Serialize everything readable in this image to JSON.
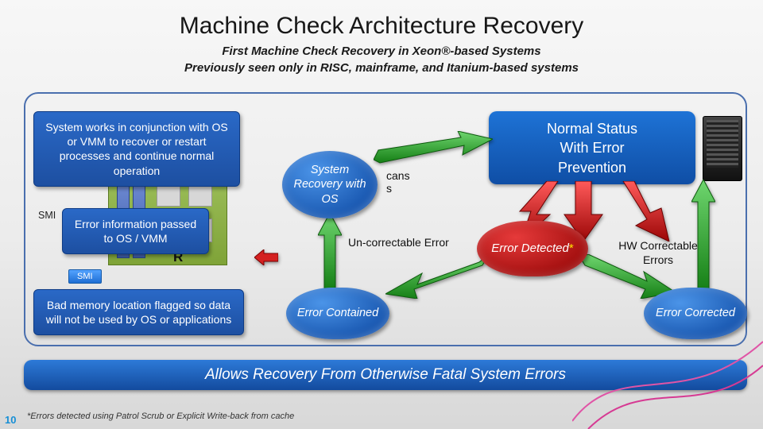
{
  "title": "Machine Check Architecture Recovery",
  "subtitle_1": "First Machine Check Recovery in Xeon®-based Systems",
  "subtitle_2": "Previously seen only in RISC, mainframe, and Itanium-based systems",
  "callouts": {
    "system_works": "System works in conjunction with OS or VMM to recover or restart processes and continue normal operation",
    "error_info": "Error information passed to OS / VMM",
    "bad_memory": "Bad memory location flagged so data will not be used by OS or applications"
  },
  "status_box": {
    "line1": "Normal Status",
    "line2": "With Error",
    "line3": "Prevention"
  },
  "bubbles": {
    "system_recovery": "System Recovery with OS",
    "error_detected": "Error Detected",
    "error_detected_marker": "*",
    "error_contained": "Error Contained",
    "error_corrected": "Error Corrected"
  },
  "labels": {
    "scans": "cans\ns",
    "uncorrectable": "Un-correctable Error",
    "hw_correctable": "HW Correctable Errors",
    "smi_outer": "SMI",
    "smi_inner": "SMI",
    "r_label": "R"
  },
  "conclusion": "Allows Recovery From Otherwise Fatal System Errors",
  "footnote": "*Errors detected using Patrol Scrub or Explicit Write-back from cache",
  "page_number": "10",
  "colors": {
    "blue_primary": "#1a59b2",
    "red_primary": "#b31313",
    "green_primary": "#2f9a2f"
  }
}
